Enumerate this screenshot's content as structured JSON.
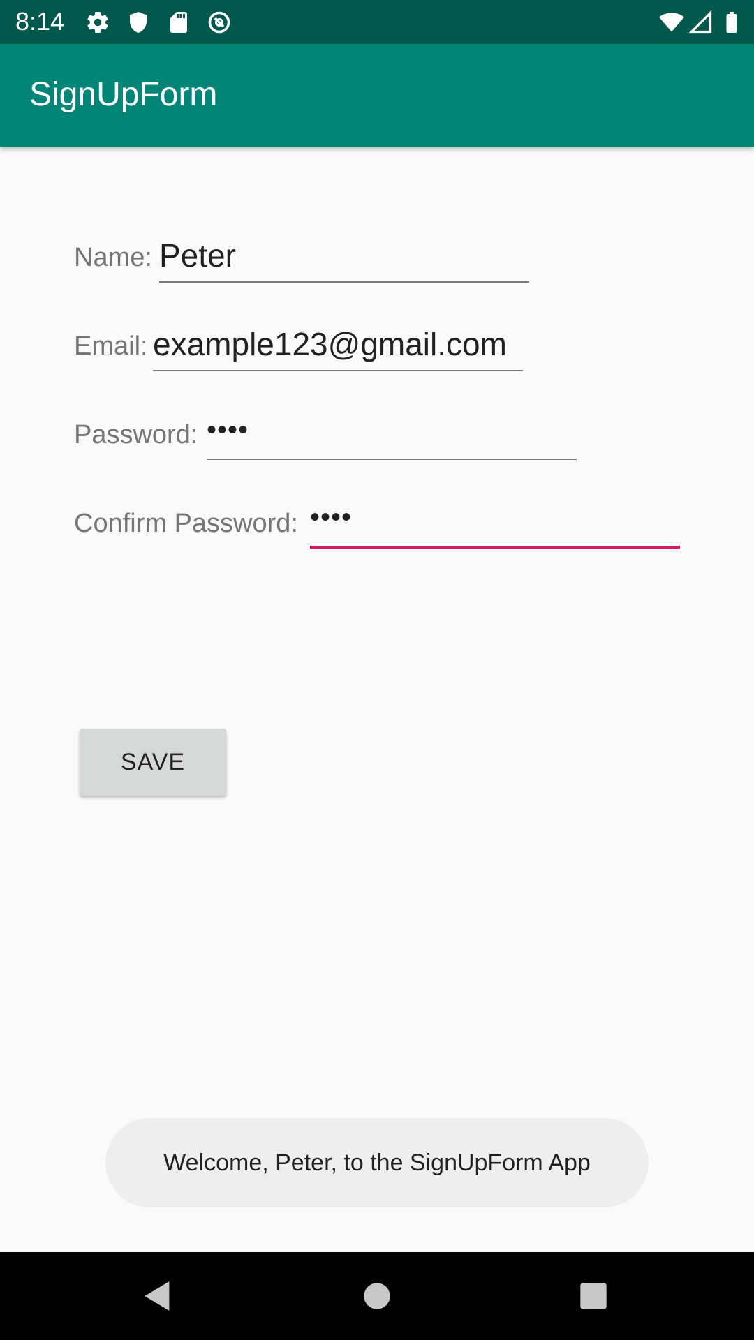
{
  "status_bar": {
    "time": "8:14",
    "icons_left": [
      "gear-icon",
      "shield-icon",
      "sd-card-icon",
      "no-sync-icon"
    ],
    "icons_right": [
      "wifi-icon",
      "signal-icon",
      "battery-icon"
    ],
    "background_color": "#00574b"
  },
  "app_bar": {
    "title": "SignUpForm",
    "background_color": "#008577"
  },
  "form": {
    "name": {
      "label": "Name:",
      "value": "Peter"
    },
    "email": {
      "label": "Email:",
      "value": "example123@gmail.com"
    },
    "password": {
      "label": "Password:",
      "value": "••••"
    },
    "confirm_password": {
      "label": "Confirm Password:",
      "value": "••••",
      "focused": true
    },
    "accent_color": "#d81b60"
  },
  "save_button": {
    "label": "SAVE"
  },
  "toast": {
    "message": "Welcome, Peter, to the SignUpForm App"
  },
  "nav_bar": {
    "buttons": [
      "back-icon",
      "home-icon",
      "recents-icon"
    ]
  }
}
